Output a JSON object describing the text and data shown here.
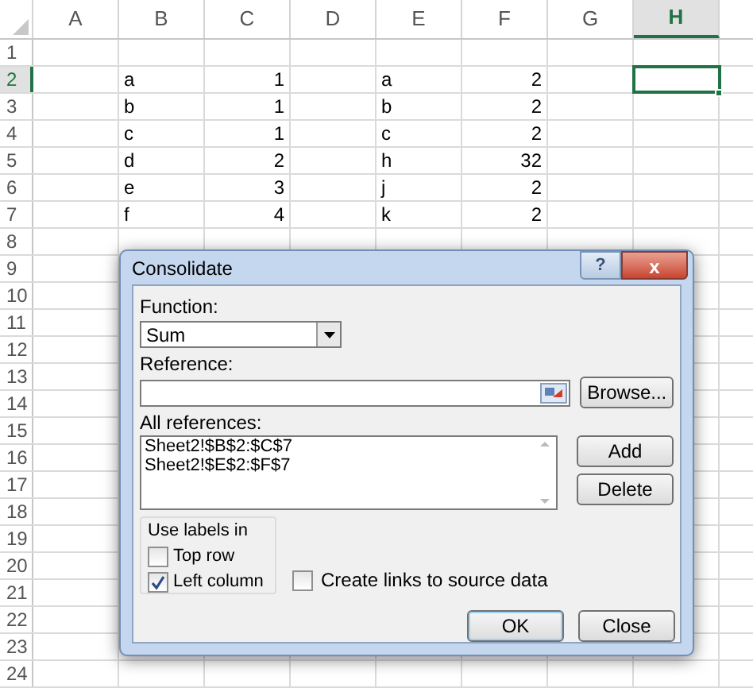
{
  "sheet": {
    "columns": [
      {
        "label": "A",
        "selected": false
      },
      {
        "label": "B",
        "selected": false
      },
      {
        "label": "C",
        "selected": false
      },
      {
        "label": "D",
        "selected": false
      },
      {
        "label": "E",
        "selected": false
      },
      {
        "label": "F",
        "selected": false
      },
      {
        "label": "G",
        "selected": false
      },
      {
        "label": "H",
        "selected": true
      }
    ],
    "rows": [
      {
        "label": "1",
        "selected": false
      },
      {
        "label": "2",
        "selected": true,
        "cells": {
          "col_b": "a",
          "col_c": "1",
          "col_e": "a",
          "col_f": "2"
        }
      },
      {
        "label": "3",
        "selected": false,
        "cells": {
          "col_b": "b",
          "col_c": "1",
          "col_e": "b",
          "col_f": "2"
        }
      },
      {
        "label": "4",
        "selected": false,
        "cells": {
          "col_b": "c",
          "col_c": "1",
          "col_e": "c",
          "col_f": "2"
        }
      },
      {
        "label": "5",
        "selected": false,
        "cells": {
          "col_b": "d",
          "col_c": "2",
          "col_e": "h",
          "col_f": "32"
        }
      },
      {
        "label": "6",
        "selected": false,
        "cells": {
          "col_b": "e",
          "col_c": "3",
          "col_e": "j",
          "col_f": "2"
        }
      },
      {
        "label": "7",
        "selected": false,
        "cells": {
          "col_b": "f",
          "col_c": "4",
          "col_e": "k",
          "col_f": "2"
        }
      },
      {
        "label": "8",
        "selected": false
      },
      {
        "label": "9",
        "selected": false
      },
      {
        "label": "10",
        "selected": false
      },
      {
        "label": "11",
        "selected": false
      },
      {
        "label": "12",
        "selected": false
      },
      {
        "label": "13",
        "selected": false
      },
      {
        "label": "14",
        "selected": false
      },
      {
        "label": "15",
        "selected": false
      },
      {
        "label": "16",
        "selected": false
      },
      {
        "label": "17",
        "selected": false
      },
      {
        "label": "18",
        "selected": false
      },
      {
        "label": "19",
        "selected": false
      },
      {
        "label": "20",
        "selected": false
      },
      {
        "label": "21",
        "selected": false
      },
      {
        "label": "22",
        "selected": false
      },
      {
        "label": "23",
        "selected": false
      },
      {
        "label": "24",
        "selected": false
      }
    ]
  },
  "dialog": {
    "title": "Consolidate",
    "help_button": "?",
    "close_button": "x",
    "function": {
      "label": "Function:",
      "value": "Sum"
    },
    "reference": {
      "label": "Reference:"
    },
    "browse_button": "Browse...",
    "all_references": {
      "label": "All references:",
      "items": [
        "Sheet2!$B$2:$C$7",
        "Sheet2!$E$2:$F$7"
      ]
    },
    "add_button": "Add",
    "delete_button": "Delete",
    "use_labels": {
      "title": "Use labels in",
      "options": [
        {
          "label": "Top row",
          "checked": false
        },
        {
          "label": "Left column",
          "checked": true
        }
      ]
    },
    "create_links": {
      "label": "Create links to source data",
      "checked": false
    },
    "ok_button": "OK",
    "cancel_button": "Close"
  }
}
